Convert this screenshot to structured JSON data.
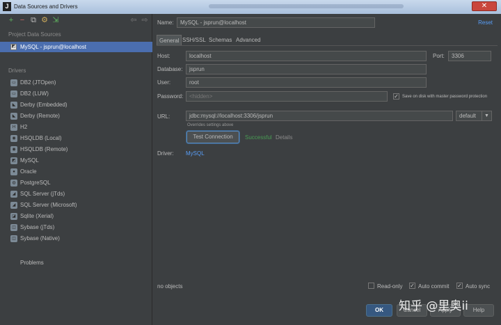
{
  "window": {
    "title": "Data Sources and Drivers",
    "close_glyph": "✕"
  },
  "left": {
    "toolbar": {
      "add": "+",
      "remove": "−",
      "copy": "⧉",
      "settings": "⚙",
      "import": "⇲",
      "back": "⇦",
      "forward": "⇨"
    },
    "project_header": "Project Data Sources",
    "data_source": {
      "label": "MySQL - jsprun@localhost",
      "icon": "mysql-datasource-icon"
    },
    "drivers_header": "Drivers",
    "drivers": [
      {
        "label": "DB2 (JTOpen)",
        "icon": "db2-icon"
      },
      {
        "label": "DB2 (LUW)",
        "icon": "db2-icon"
      },
      {
        "label": "Derby (Embedded)",
        "icon": "derby-icon"
      },
      {
        "label": "Derby (Remote)",
        "icon": "derby-icon"
      },
      {
        "label": "H2",
        "icon": "h2-icon"
      },
      {
        "label": "HSQLDB (Local)",
        "icon": "hsqldb-icon"
      },
      {
        "label": "HSQLDB (Remote)",
        "icon": "hsqldb-icon"
      },
      {
        "label": "MySQL",
        "icon": "mysql-icon"
      },
      {
        "label": "Oracle",
        "icon": "oracle-icon"
      },
      {
        "label": "PostgreSQL",
        "icon": "postgresql-icon"
      },
      {
        "label": "SQL Server (jTds)",
        "icon": "sqlserver-icon"
      },
      {
        "label": "SQL Server (Microsoft)",
        "icon": "sqlserver-icon"
      },
      {
        "label": "Sqlite (Xerial)",
        "icon": "sqlite-icon"
      },
      {
        "label": "Sybase (jTds)",
        "icon": "sybase-icon"
      },
      {
        "label": "Sybase (Native)",
        "icon": "sybase-icon"
      }
    ],
    "problems": "Problems"
  },
  "right": {
    "name_label": "Name:",
    "name_value": "MySQL - jsprun@localhost",
    "reset": "Reset",
    "tabs": [
      "General",
      "SSH/SSL",
      "Schemas",
      "Advanced"
    ],
    "host_label": "Host:",
    "host_value": "localhost",
    "port_label": "Port:",
    "port_value": "3306",
    "database_label": "Database:",
    "database_value": "jsprun",
    "user_label": "User:",
    "user_value": "root",
    "password_label": "Password:",
    "password_placeholder": "<hidden>",
    "save_on_disk_label": "Save on disk with master password protection",
    "url_label": "URL:",
    "url_value": "jdbc:mysql://localhost:3306/jsprun",
    "url_mode": "default",
    "overrides_hint": "Overrides settings above",
    "test_connection": "Test Connection",
    "successful": "Successful",
    "details": "Details",
    "driver_label": "Driver:",
    "driver_value": "MySQL",
    "no_objects": "no objects",
    "read_only": "Read-only",
    "auto_commit": "Auto commit",
    "auto_sync": "Auto sync",
    "ok": "OK",
    "cancel": "Cancel",
    "apply": "Apply",
    "help": "Help"
  },
  "watermark": "知乎 @里奥ii"
}
